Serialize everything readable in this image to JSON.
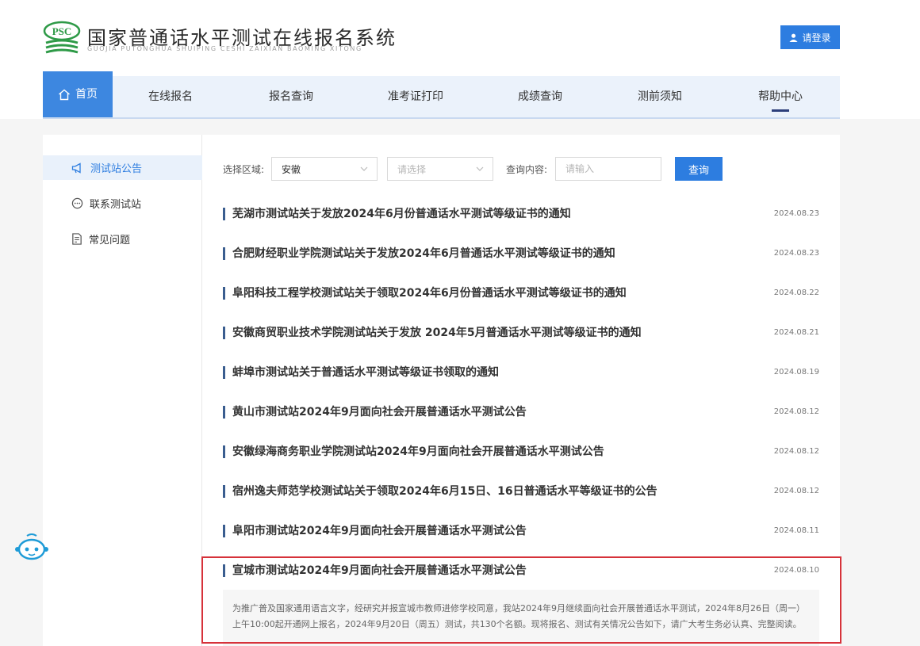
{
  "header": {
    "logo_text": "PSC",
    "title": "国家普通话水平测试在线报名系统",
    "subtitle": "GUOJIA PUTONGHUA SHUIPING CESHI ZAIXIAN BAOMING XITONG",
    "login_label": "请登录"
  },
  "nav": {
    "home": "首页",
    "items": [
      "在线报名",
      "报名查询",
      "准考证打印",
      "成绩查询",
      "测前须知",
      "帮助中心"
    ]
  },
  "sidebar": {
    "items": [
      {
        "label": "测试站公告",
        "icon": "megaphone-icon"
      },
      {
        "label": "联系测试站",
        "icon": "chat-icon"
      },
      {
        "label": "常见问题",
        "icon": "document-icon"
      }
    ]
  },
  "filters": {
    "region_label": "选择区域:",
    "region_value": "安徽",
    "sub_region_placeholder": "请选择",
    "query_label": "查询内容:",
    "query_placeholder": "请输入",
    "query_button": "查询"
  },
  "notices": [
    {
      "title": "芜湖市测试站关于发放2024年6月份普通话水平测试等级证书的通知",
      "date": "2024.08.23"
    },
    {
      "title": "合肥财经职业学院测试站关于发放2024年6月普通话水平测试等级证书的通知",
      "date": "2024.08.23"
    },
    {
      "title": "阜阳科技工程学校测试站关于领取2024年6月份普通话水平测试等级证书的通知",
      "date": "2024.08.22"
    },
    {
      "title": "安徽商贸职业技术学院测试站关于发放 2024年5月普通话水平测试等级证书的通知",
      "date": "2024.08.21"
    },
    {
      "title": "蚌埠市测试站关于普通话水平测试等级证书领取的通知",
      "date": "2024.08.19"
    },
    {
      "title": "黄山市测试站2024年9月面向社会开展普通话水平测试公告",
      "date": "2024.08.12"
    },
    {
      "title": "安徽绿海商务职业学院测试站2024年9月面向社会开展普通话水平测试公告",
      "date": "2024.08.12"
    },
    {
      "title": "宿州逸夫师范学校测试站关于领取2024年6月15日、16日普通话水平等级证书的公告",
      "date": "2024.08.12"
    },
    {
      "title": "阜阳市测试站2024年9月面向社会开展普通话水平测试公告",
      "date": "2024.08.11"
    },
    {
      "title": "宣城市测试站2024年9月面向社会开展普通话水平测试公告",
      "date": "2024.08.10"
    }
  ],
  "expanded_excerpt": "为推广普及国家通用语言文字，经研究并报宣城市教师进修学校同意，我站2024年9月继续面向社会开展普通话水平测试，2024年8月26日（周一）上午10:00起开通网上报名，2024年9月20日（周五）测试，共130个名额。现将报名、测试有关情况公告如下，请广大考生务必认真、完整阅读。",
  "colors": {
    "primary": "#2d7de0",
    "nav_bg": "#ebf2fb",
    "highlight_border": "#d6323a",
    "logo_green": "#2e9a47"
  }
}
